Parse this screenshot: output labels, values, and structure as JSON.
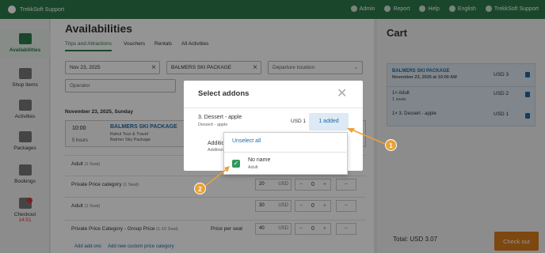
{
  "topbar": {
    "brand": "TrekkSoft Support",
    "admin": "Admin",
    "report": "Report",
    "help": "Help",
    "language": "English",
    "account": "TrekkSoft Support"
  },
  "sidebar": {
    "items": [
      {
        "label": "Availabilities"
      },
      {
        "label": "Shop items"
      },
      {
        "label": "Activities"
      },
      {
        "label": "Packages"
      },
      {
        "label": "Bookings"
      },
      {
        "label": "Checkout",
        "sub": "14:51"
      }
    ]
  },
  "main": {
    "title": "Availabilities",
    "tabs": [
      "Trips and Attractions",
      "Vouchers",
      "Rentals",
      "All Activities"
    ],
    "filters": {
      "date": "Nov 23, 2025",
      "package": "BALMERS SKI PACKAGE",
      "departure": "Departure location",
      "operator": "Operator"
    },
    "date_heading": "November 23, 2025, Sunday",
    "event": {
      "time": "10:00",
      "duration": "5 hours",
      "name": "BALMERS SKI PACKAGE",
      "sub1": "Rahul Tour & Travel",
      "sub2": "Balmer Sky Package"
    },
    "rows": [
      {
        "label": "Adult",
        "seat": "(1 Seat)",
        "price": "",
        "pps": ""
      },
      {
        "label": "Private Price category",
        "seat": "(1 Seat)",
        "price": "20",
        "pps": ""
      },
      {
        "label": "Adult",
        "seat": "(1 Seat)",
        "price": "30",
        "pps": ""
      },
      {
        "label": "Private Price Category - Group Price",
        "seat": "(1-10 Seat)",
        "price": "40",
        "pps": "Price per seat"
      }
    ],
    "currency": "USD",
    "qty": "0",
    "add_addons": "Add add-ons",
    "add_price": "Add new custom price category"
  },
  "cart": {
    "title": "Cart",
    "items": [
      {
        "name": "BALMERS SKI PACKAGE",
        "sub": "November 23, 2025 at 10:00 AM",
        "price": "USD 3"
      },
      {
        "name": "1× Adult",
        "sub": "1 seats",
        "price": "USD 2"
      },
      {
        "name": "1× 3. Dessert - apple",
        "sub": "",
        "price": "USD 1"
      }
    ],
    "total": "Total: USD 3.07",
    "checkout": "Check out"
  },
  "modal": {
    "title": "Select addons",
    "addon1": {
      "name": "3. Dessert - apple",
      "sub": "Dessert - apple",
      "price": "USD 1",
      "btn": "1 added"
    },
    "addon2": {
      "name": "Additional",
      "sub": "Additional Ge"
    },
    "unselect": "Unselect all",
    "option": {
      "name": "No name",
      "sub": "Adult"
    }
  },
  "callouts": [
    "1",
    "2"
  ],
  "colors": {
    "green": "#2d7a4a",
    "accent_blue": "#1e6aa6",
    "orange": "#d87a1c",
    "callout": "#e9a23a"
  }
}
